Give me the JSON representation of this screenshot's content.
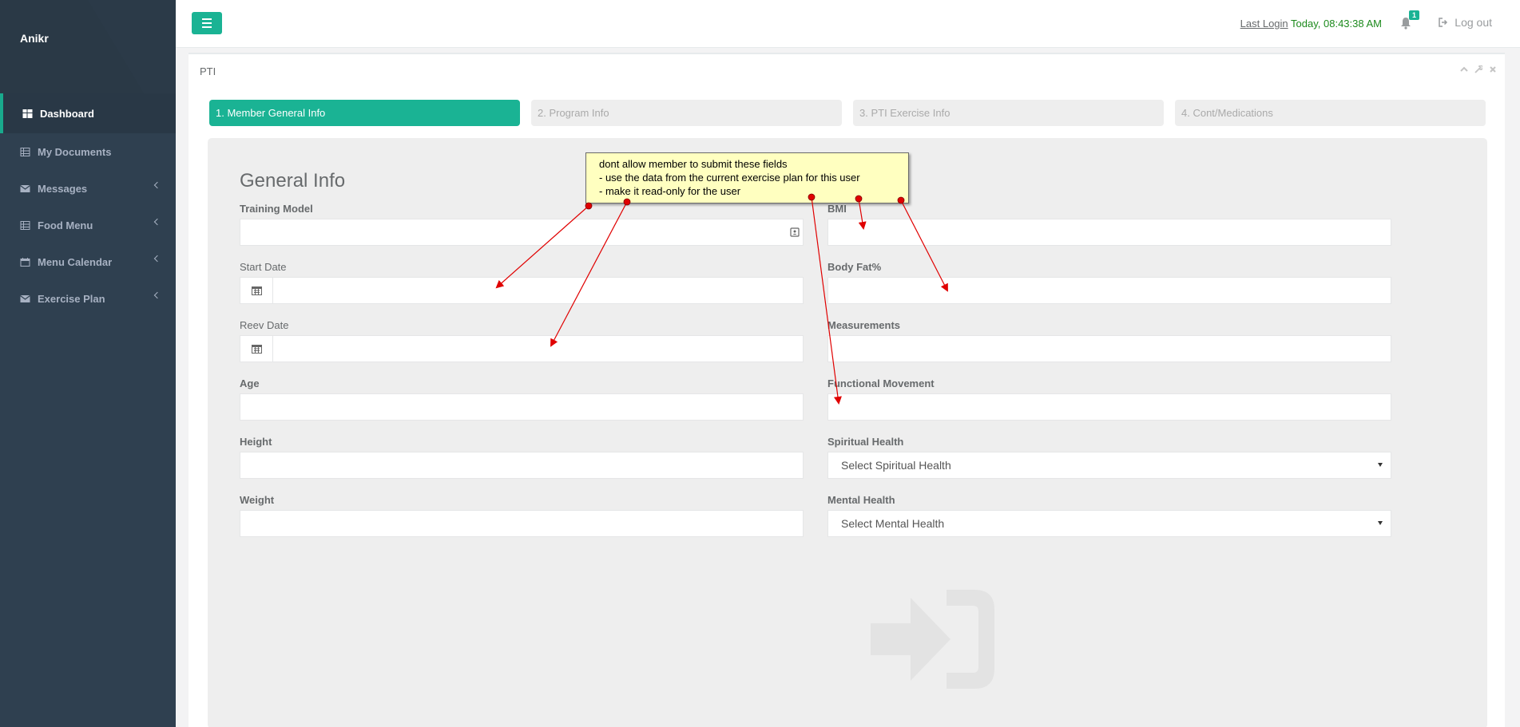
{
  "sidebar": {
    "brand": "Anikr",
    "items": [
      {
        "label": "Dashboard",
        "icon": "dashboard-icon"
      },
      {
        "label": "My Documents",
        "icon": "table-icon"
      },
      {
        "label": "Messages",
        "icon": "envelope-icon"
      },
      {
        "label": "Food Menu",
        "icon": "table-icon"
      },
      {
        "label": "Menu Calendar",
        "icon": "calendar-icon"
      },
      {
        "label": "Exercise Plan",
        "icon": "envelope-icon"
      }
    ]
  },
  "topbar": {
    "last_login_label": "Last Login",
    "last_login_value": "Today, 08:43:38 AM",
    "notification_count": "1",
    "logout_label": "Log out"
  },
  "panel": {
    "title": "PTI",
    "steps": [
      "1. Member General Info",
      "2. Program Info",
      "3. PTI Exercise Info",
      "4. Cont/Medications"
    ],
    "section_title": "General Info"
  },
  "form": {
    "left": {
      "training_model": "Training Model",
      "start_date": "Start Date",
      "reev_date": "Reev Date",
      "age": "Age",
      "height": "Height",
      "weight": "Weight"
    },
    "right": {
      "bmi": "BMI",
      "body_fat": "Body Fat%",
      "measurements": "Measurements",
      "functional_movement": "Functional Movement",
      "spiritual_health": "Spiritual Health",
      "spiritual_health_placeholder": "Select Spiritual Health",
      "mental_health": "Mental Health",
      "mental_health_placeholder": "Select Mental Health"
    }
  },
  "annotation": {
    "line1": "dont allow member to submit these fields",
    "line2": "- use the data from the current exercise plan for this user",
    "line3": "- make it read-only for the user"
  },
  "colors": {
    "accent": "#1ab394",
    "sidebar": "#2f4050",
    "arrow": "#e00000",
    "note_bg": "#ffffc0"
  }
}
